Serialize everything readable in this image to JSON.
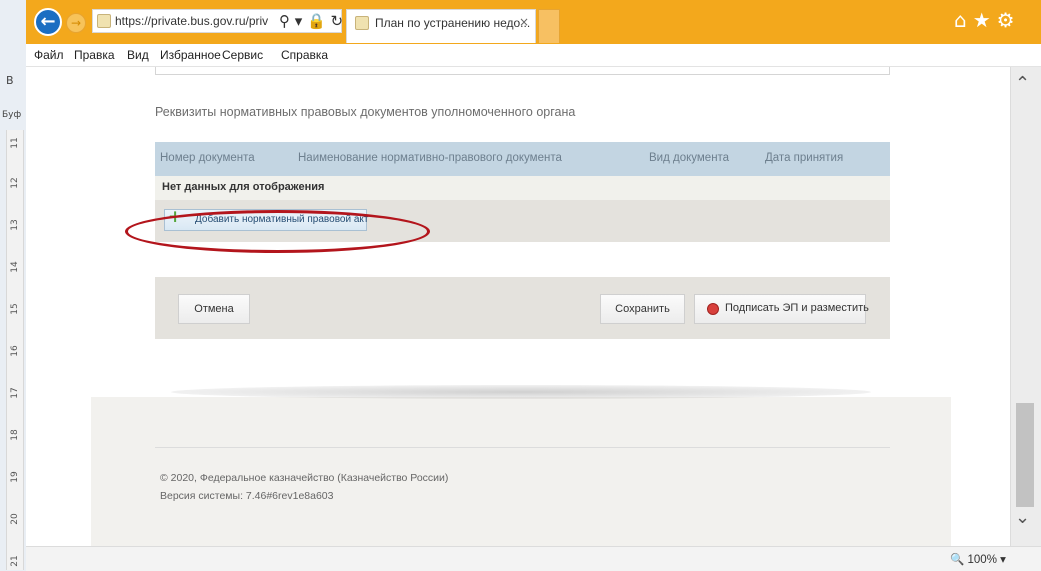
{
  "browser": {
    "address_url": "https://private.bus.gov.ru/priv",
    "tab_title": "План по устранению недо...",
    "tab_close": "×",
    "back_glyph": "←",
    "forward_glyph": "→",
    "address_icons": "⚲ ▾ 🔒 ↻",
    "right_icons": "⌂★⚙"
  },
  "menu": {
    "items": [
      "Файл",
      "Правка",
      "Вид",
      "Избранное",
      "Сервис",
      "Справка"
    ]
  },
  "side_app": {
    "letter_b": "В",
    "letter_buf": "Буф",
    "ruler_marker": "L",
    "ruler_numbers": [
      "11",
      "12",
      "13",
      "14",
      "15",
      "16",
      "17",
      "18",
      "19",
      "20",
      "21"
    ]
  },
  "page": {
    "section_title": "Реквизиты нормативных правовых документов уполномоченного органа",
    "table": {
      "columns": [
        "Номер документа",
        "Наименование нормативно-правового документа",
        "Вид документа",
        "Дата принятия"
      ],
      "empty_text": "Нет данных для отображения"
    },
    "add_button": "Добавить нормативный правовой акт",
    "add_icon": "+",
    "actions": {
      "cancel": "Отмена",
      "save": "Сохранить",
      "sign": "Подписать ЭП и разместить"
    },
    "footer": {
      "copyright": "© 2020, Федеральное казначейство (Казначейство России)",
      "version": "Версия системы: 7.46#6rev1e8a603"
    }
  },
  "scrollbar": {
    "up": "⌃",
    "down": "⌄"
  },
  "status": {
    "zoom": "🔍 100%  ▾"
  },
  "colors": {
    "titlebar": "#f3a81c",
    "table_header": "#c3d5e2",
    "highlight_oval": "#b3151c",
    "actions_bg": "#e4e2dd"
  }
}
